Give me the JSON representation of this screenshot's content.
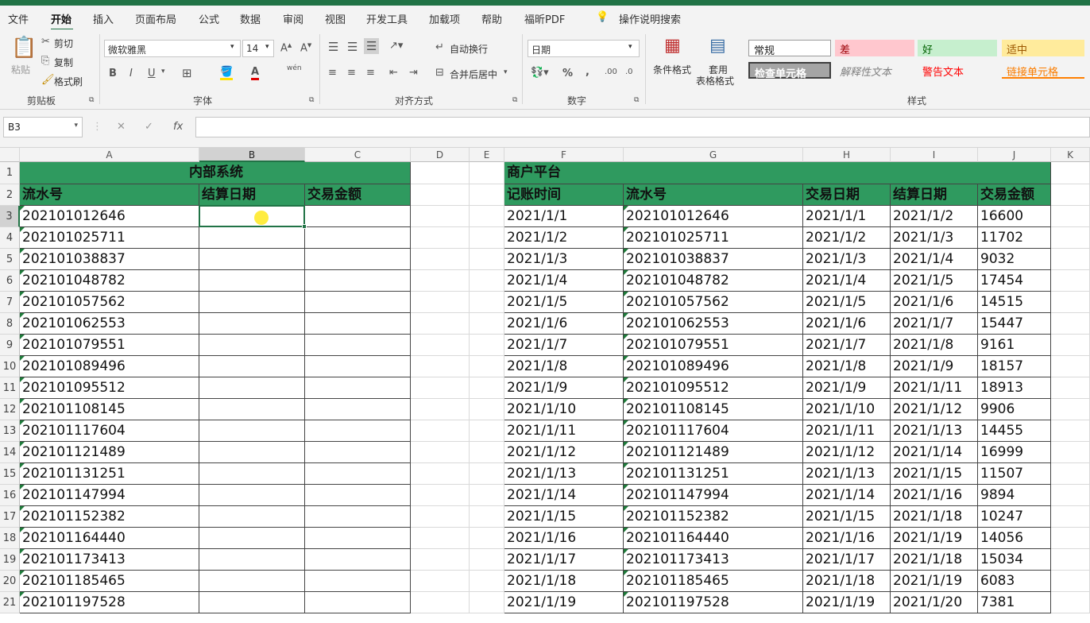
{
  "menu": {
    "items": [
      "文件",
      "开始",
      "插入",
      "页面布局",
      "公式",
      "数据",
      "审阅",
      "视图",
      "开发工具",
      "加载项",
      "帮助",
      "福昕PDF"
    ],
    "active_index": 1,
    "tell_me": "操作说明搜索"
  },
  "ribbon": {
    "clipboard": {
      "paste": "粘贴",
      "cut": "剪切",
      "copy": "复制",
      "format_painter": "格式刷",
      "group": "剪贴板"
    },
    "font": {
      "name": "微软雅黑",
      "size": "14",
      "bold": "B",
      "italic": "I",
      "underline": "U",
      "group": "字体",
      "phonetic": "wén"
    },
    "alignment": {
      "wrap": "自动换行",
      "merge": "合并后居中",
      "group": "对齐方式"
    },
    "number": {
      "format": "日期",
      "percent": "%",
      "comma": ",",
      "group": "数字"
    },
    "styles": {
      "conditional": "条件格式",
      "table_l1": "套用",
      "table_l2": "表格格式",
      "group": "样式",
      "cells": [
        "常规",
        "差",
        "好",
        "适中",
        "检查单元格",
        "解释性文本",
        "警告文本",
        "链接单元格"
      ]
    }
  },
  "formula_bar": {
    "name_box": "B3",
    "fx": "fx",
    "value": ""
  },
  "columns": [
    "A",
    "B",
    "C",
    "D",
    "E",
    "F",
    "G",
    "H",
    "I",
    "J",
    "K"
  ],
  "rows": [
    1,
    2,
    3,
    4,
    5,
    6,
    7,
    8,
    9,
    10,
    11,
    12,
    13,
    14,
    15,
    16,
    17,
    18,
    19,
    20,
    21
  ],
  "left_table": {
    "title": "内部系统",
    "headers": [
      "流水号",
      "结算日期",
      "交易金额"
    ],
    "serials": [
      "202101012646",
      "202101025711",
      "202101038837",
      "202101048782",
      "202101057562",
      "202101062553",
      "202101079551",
      "202101089496",
      "202101095512",
      "202101108145",
      "202101117604",
      "202101121489",
      "202101131251",
      "202101147994",
      "202101152382",
      "202101164440",
      "202101173413",
      "202101185465",
      "202101197528"
    ]
  },
  "right_table": {
    "title": "商户平台",
    "headers": [
      "记账时间",
      "流水号",
      "交易日期",
      "结算日期",
      "交易金额"
    ],
    "rows": [
      [
        "2021/1/1",
        "202101012646",
        "2021/1/1",
        "2021/1/2",
        "16600"
      ],
      [
        "2021/1/2",
        "202101025711",
        "2021/1/2",
        "2021/1/3",
        "11702"
      ],
      [
        "2021/1/3",
        "202101038837",
        "2021/1/3",
        "2021/1/4",
        "9032"
      ],
      [
        "2021/1/4",
        "202101048782",
        "2021/1/4",
        "2021/1/5",
        "17454"
      ],
      [
        "2021/1/5",
        "202101057562",
        "2021/1/5",
        "2021/1/6",
        "14515"
      ],
      [
        "2021/1/6",
        "202101062553",
        "2021/1/6",
        "2021/1/7",
        "15447"
      ],
      [
        "2021/1/7",
        "202101079551",
        "2021/1/7",
        "2021/1/8",
        "9161"
      ],
      [
        "2021/1/8",
        "202101089496",
        "2021/1/8",
        "2021/1/9",
        "18157"
      ],
      [
        "2021/1/9",
        "202101095512",
        "2021/1/9",
        "2021/1/11",
        "18913"
      ],
      [
        "2021/1/10",
        "202101108145",
        "2021/1/10",
        "2021/1/12",
        "9906"
      ],
      [
        "2021/1/11",
        "202101117604",
        "2021/1/11",
        "2021/1/13",
        "14455"
      ],
      [
        "2021/1/12",
        "202101121489",
        "2021/1/12",
        "2021/1/14",
        "16999"
      ],
      [
        "2021/1/13",
        "202101131251",
        "2021/1/13",
        "2021/1/15",
        "11507"
      ],
      [
        "2021/1/14",
        "202101147994",
        "2021/1/14",
        "2021/1/16",
        "9894"
      ],
      [
        "2021/1/15",
        "202101152382",
        "2021/1/15",
        "2021/1/18",
        "10247"
      ],
      [
        "2021/1/16",
        "202101164440",
        "2021/1/16",
        "2021/1/19",
        "14056"
      ],
      [
        "2021/1/17",
        "202101173413",
        "2021/1/17",
        "2021/1/18",
        "15034"
      ],
      [
        "2021/1/18",
        "202101185465",
        "2021/1/18",
        "2021/1/19",
        "6083"
      ],
      [
        "2021/1/19",
        "202101197528",
        "2021/1/19",
        "2021/1/20",
        "7381"
      ]
    ]
  },
  "colors": {
    "brand": "#217346",
    "header_fill": "#2f9a5f",
    "bad_fill": "#ffc7ce",
    "good_fill": "#c6efce",
    "neutral_fill": "#ffeb9c"
  }
}
